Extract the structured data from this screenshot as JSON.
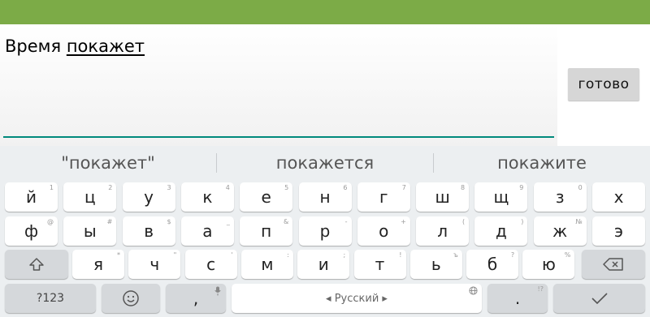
{
  "editor": {
    "text_plain": "Время ",
    "text_composing": "покажет"
  },
  "done_button": {
    "label": "готово"
  },
  "suggestions": [
    "\"покажет\"",
    "покажется",
    "покажите"
  ],
  "keyboard": {
    "row1": [
      {
        "ch": "й",
        "hint": "1"
      },
      {
        "ch": "ц",
        "hint": "2"
      },
      {
        "ch": "у",
        "hint": "3"
      },
      {
        "ch": "к",
        "hint": "4"
      },
      {
        "ch": "е",
        "hint": "5"
      },
      {
        "ch": "н",
        "hint": "6"
      },
      {
        "ch": "г",
        "hint": "7"
      },
      {
        "ch": "ш",
        "hint": "8"
      },
      {
        "ch": "щ",
        "hint": "9"
      },
      {
        "ch": "з",
        "hint": "0"
      },
      {
        "ch": "х",
        "hint": ""
      }
    ],
    "row2": [
      {
        "ch": "ф",
        "hint": "@"
      },
      {
        "ch": "ы",
        "hint": "#"
      },
      {
        "ch": "в",
        "hint": "$"
      },
      {
        "ch": "а",
        "hint": "_"
      },
      {
        "ch": "п",
        "hint": "&"
      },
      {
        "ch": "р",
        "hint": "-"
      },
      {
        "ch": "о",
        "hint": "+"
      },
      {
        "ch": "л",
        "hint": "("
      },
      {
        "ch": "д",
        "hint": ")"
      },
      {
        "ch": "ж",
        "hint": "№"
      },
      {
        "ch": "э",
        "hint": ""
      }
    ],
    "row3": [
      {
        "ch": "я",
        "hint": "*"
      },
      {
        "ch": "ч",
        "hint": "\""
      },
      {
        "ch": "с",
        "hint": "'"
      },
      {
        "ch": "м",
        "hint": ":"
      },
      {
        "ch": "и",
        "hint": ";"
      },
      {
        "ch": "т",
        "hint": "!"
      },
      {
        "ch": "ь",
        "hint": "ъ"
      },
      {
        "ch": "б",
        "hint": "?"
      },
      {
        "ch": "ю",
        "hint": "%"
      }
    ],
    "symbols_label": "?123",
    "comma_label": ",",
    "space_label": "◂ Русский ▸",
    "period_label": ".",
    "period_hint": "!?",
    "icons": {
      "shift": "shift-icon",
      "backspace": "backspace-icon",
      "emoji": "emoji-icon",
      "mic": "mic-icon",
      "globe": "globe-icon",
      "enter": "checkmark-icon"
    }
  },
  "colors": {
    "topbar": "#7cab47",
    "underline": "#00897b",
    "keyboard_bg": "#eceff1",
    "key": "#ffffff",
    "key_dark": "#d5d8db"
  }
}
